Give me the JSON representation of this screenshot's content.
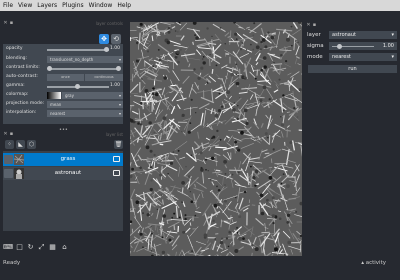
{
  "menu": [
    "File",
    "View",
    "Layers",
    "Plugins",
    "Window",
    "Help"
  ],
  "layer_controls": {
    "title": "layer controls",
    "rows": [
      {
        "label": "opacity",
        "value": "1.00",
        "level": 1.0
      },
      {
        "label": "blending:",
        "value": "translucent_no_depth"
      },
      {
        "label": "contrast limits:"
      },
      {
        "label": "auto-contrast:",
        "once": "once",
        "continuous": "continuous"
      },
      {
        "label": "gamma:",
        "value": "1.00",
        "level": 0.5
      },
      {
        "label": "colormap:",
        "value": "gray"
      },
      {
        "label": "projection mode:",
        "value": "mean"
      },
      {
        "label": "interpolation:",
        "value": "nearest"
      }
    ]
  },
  "layer_list": {
    "title": "layer list",
    "layers": [
      {
        "name": "grass",
        "selected": true
      },
      {
        "name": "astronaut",
        "selected": false
      }
    ]
  },
  "icons": {
    "dock_close": "close-icon",
    "dock_float": "float-icon",
    "pan_zoom": "move-icon",
    "transform": "transform-icon",
    "new_points": "points-icon",
    "new_shapes": "shapes-icon",
    "new_labels": "labels-icon",
    "delete": "trash-icon",
    "visibility": "eye-icon",
    "image_type": "image-layer-icon",
    "console": "console-icon",
    "ndisplay": "square-icon",
    "roll": "roll-icon",
    "transpose": "transpose-icon",
    "grid": "grid-icon",
    "home": "home-icon"
  },
  "plugin_widget": {
    "layer_label": "layer",
    "layer_value": "astronaut",
    "sigma_label": "sigma",
    "sigma_value": "1.00",
    "sigma_level": 0.15,
    "mode_label": "mode",
    "mode_value": "nearest",
    "run_label": "run"
  },
  "status": {
    "text": "Ready",
    "activity": "activity"
  },
  "colors": {
    "accent": "#007acc",
    "panel": "#414851",
    "background": "#262930"
  }
}
